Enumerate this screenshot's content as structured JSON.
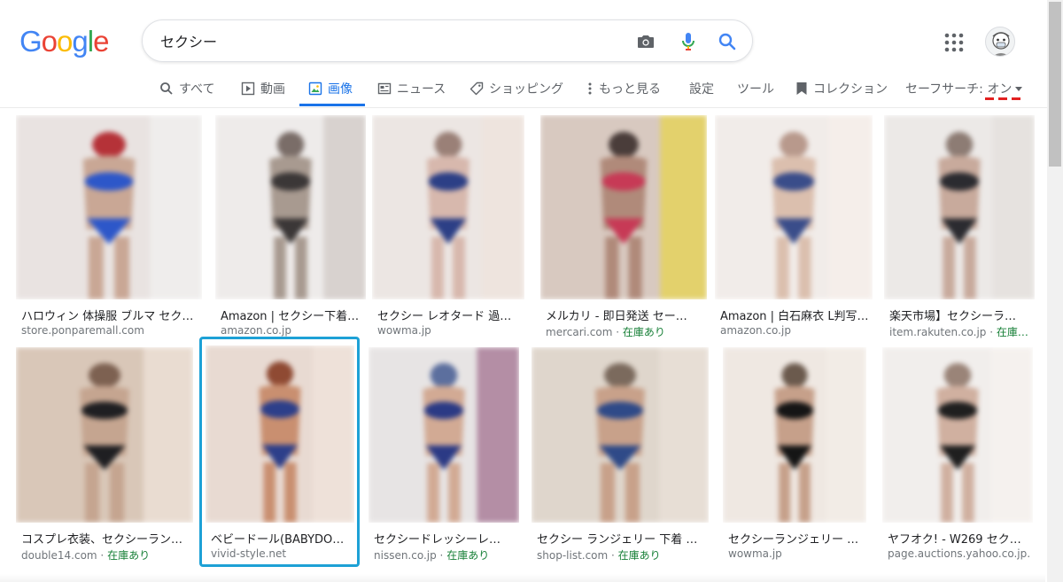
{
  "logo": {
    "letters": [
      {
        "ch": "G",
        "color": "#4285F4"
      },
      {
        "ch": "o",
        "color": "#EA4335"
      },
      {
        "ch": "o",
        "color": "#FBBC05"
      },
      {
        "ch": "g",
        "color": "#4285F4"
      },
      {
        "ch": "l",
        "color": "#34A853"
      },
      {
        "ch": "e",
        "color": "#EA4335"
      }
    ]
  },
  "search": {
    "query": "セクシー",
    "placeholder": ""
  },
  "icons": {
    "camera": "camera-icon",
    "mic": "microphone-icon",
    "search": "search-icon",
    "apps": "apps-grid-icon"
  },
  "tabs": {
    "all": "すべて",
    "videos": "動画",
    "images": "画像",
    "news": "ニュース",
    "shopping": "ショッピング",
    "more": "もっと見る",
    "settings": "設定",
    "tools": "ツール",
    "collections": "コレクション",
    "safesearch": "セーフサーチ: オン"
  },
  "colors": {
    "accent": "#1a73e8",
    "in_stock": "#188038",
    "highlight": "#1da1d6"
  },
  "results": [
    {
      "caption": "ハロウィン 体操服 ブルマ セク…",
      "source": "store.ponparemall.com",
      "stock": ""
    },
    {
      "caption": "Amazon | セクシー下着…",
      "source": "amazon.co.jp",
      "stock": ""
    },
    {
      "caption": "セクシー レオタード 過…",
      "source": "wowma.jp",
      "stock": ""
    },
    {
      "caption": "メルカリ - 即日発送 セー…",
      "source": "mercari.com · ",
      "stock": "在庫あり"
    },
    {
      "caption": "Amazon | 白石麻衣 L判写…",
      "source": "amazon.co.jp",
      "stock": ""
    },
    {
      "caption": "楽天市場】セクシーラ…",
      "source": "item.rakuten.co.jp · ",
      "stock": "在庫…"
    },
    {
      "caption": "コスプレ衣装、セクシーラン…",
      "source": "double14.com · ",
      "stock": "在庫あり"
    },
    {
      "caption": "ベビードール(BABYDO…",
      "source": "vivid-style.net",
      "stock": ""
    },
    {
      "caption": "セクシードレッシーレ…",
      "source": "nissen.co.jp · ",
      "stock": "在庫あり"
    },
    {
      "caption": "セクシー ランジェリー 下着 …",
      "source": "shop-list.com · ",
      "stock": "在庫あり"
    },
    {
      "caption": "セクシーランジェリー …",
      "source": "wowma.jp",
      "stock": ""
    },
    {
      "caption": "ヤフオク! - W269 セクシ…",
      "source": "page.auctions.yahoo.co.jp…",
      "stock": ""
    }
  ]
}
